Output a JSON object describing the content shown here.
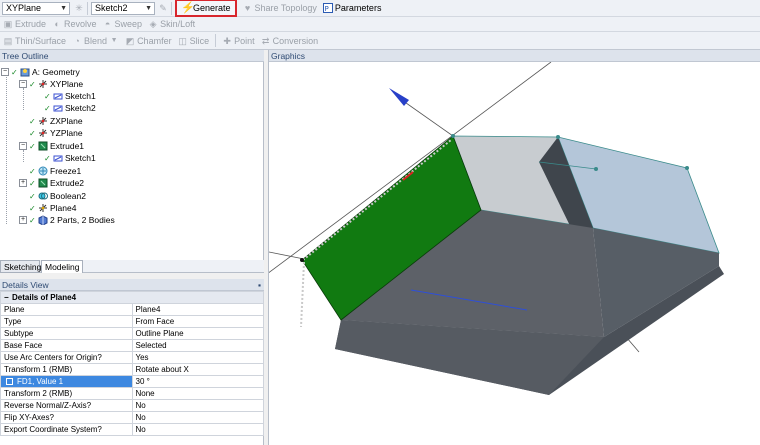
{
  "toolbar1": {
    "plane_combo": "XYPlane",
    "sketch_combo": "Sketch2",
    "generate": "Generate",
    "share_topology": "Share Topology",
    "parameters": "Parameters"
  },
  "toolbar2": {
    "extrude": "Extrude",
    "revolve": "Revolve",
    "sweep": "Sweep",
    "skin_loft": "Skin/Loft"
  },
  "toolbar3": {
    "thin_surface": "Thin/Surface",
    "blend": "Blend",
    "chamfer": "Chamfer",
    "slice": "Slice",
    "point": "Point",
    "conversion": "Conversion"
  },
  "tree": {
    "header": "Tree Outline",
    "items": [
      {
        "label": "A: Geometry"
      },
      {
        "label": "XYPlane"
      },
      {
        "label": "Sketch1"
      },
      {
        "label": "Sketch2"
      },
      {
        "label": "ZXPlane"
      },
      {
        "label": "YZPlane"
      },
      {
        "label": "Extrude1"
      },
      {
        "label": "Sketch1"
      },
      {
        "label": "Freeze1"
      },
      {
        "label": "Extrude2"
      },
      {
        "label": "Boolean2"
      },
      {
        "label": "Plane4"
      },
      {
        "label": "2 Parts, 2 Bodies"
      }
    ]
  },
  "tabs": {
    "sketching": "Sketching",
    "modeling": "Modeling"
  },
  "details": {
    "header": "Details View",
    "title": "Details of Plane4",
    "rows": [
      {
        "key": "Plane",
        "value": "Plane4"
      },
      {
        "key": "Type",
        "value": "From Face"
      },
      {
        "key": "Subtype",
        "value": "Outline Plane"
      },
      {
        "key": "Base Face",
        "value": "Selected"
      },
      {
        "key": "Use Arc Centers for Origin?",
        "value": "Yes"
      },
      {
        "key": "Transform 1 (RMB)",
        "value": "Rotate about X"
      },
      {
        "key": "FD1, Value 1",
        "value": "30 °"
      },
      {
        "key": "Transform 2 (RMB)",
        "value": "None"
      },
      {
        "key": "Reverse Normal/Z-Axis?",
        "value": "No"
      },
      {
        "key": "Flip XY-Axes?",
        "value": "No"
      },
      {
        "key": "Export Coordinate System?",
        "value": "No"
      }
    ]
  },
  "graphics": {
    "header": "Graphics"
  }
}
